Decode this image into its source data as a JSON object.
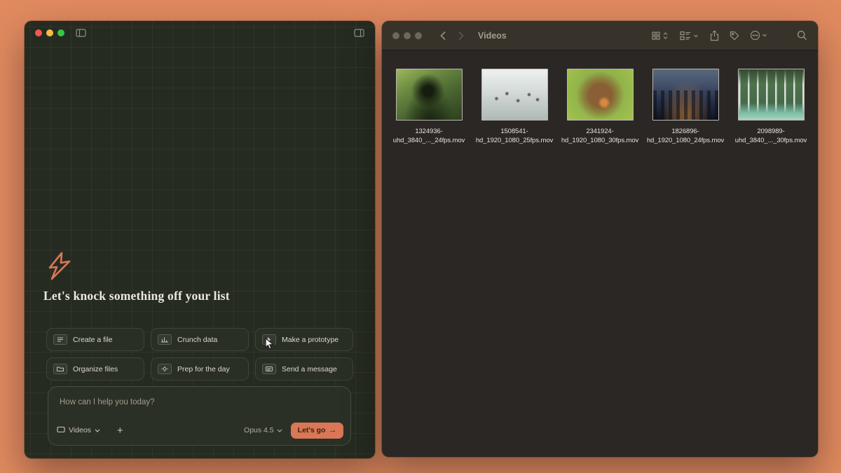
{
  "colors": {
    "desktop_bg": "#e18a60",
    "accent_orange": "#d97757",
    "assistant_window_bg": "#262b21",
    "finder_window_bg": "#2b2724"
  },
  "assistant": {
    "headline": "Let's knock something off your list",
    "actions": [
      {
        "label": "Create a file",
        "icon": "file-icon"
      },
      {
        "label": "Crunch data",
        "icon": "data-icon"
      },
      {
        "label": "Make a prototype",
        "icon": "prototype-icon"
      },
      {
        "label": "Organize files",
        "icon": "folder-icon"
      },
      {
        "label": "Prep for the day",
        "icon": "calendar-icon"
      },
      {
        "label": "Send a message",
        "icon": "message-icon"
      }
    ],
    "composer": {
      "placeholder": "How can I help you today?",
      "attachment_label": "Videos",
      "plus": "+",
      "model_label": "Opus 4.5",
      "submit_label": "Let's go",
      "submit_arrow": "→"
    }
  },
  "finder": {
    "title": "Videos",
    "files": [
      {
        "line1": "1324936-",
        "line2": "uhd_3840_..._24fps.mov",
        "thumb": "forest-valley"
      },
      {
        "line1": "1508541-",
        "line2": "hd_1920_1080_25fps.mov",
        "thumb": "snow-deer"
      },
      {
        "line1": "2341924-",
        "line2": "hd_1920_1080_30fps.mov",
        "thumb": "squirrel"
      },
      {
        "line1": "1826896-",
        "line2": "hd_1920_1080_24fps.mov",
        "thumb": "city-skyline"
      },
      {
        "line1": "2098989-",
        "line2": "uhd_3840_..._30fps.mov",
        "thumb": "waterfall"
      }
    ]
  }
}
